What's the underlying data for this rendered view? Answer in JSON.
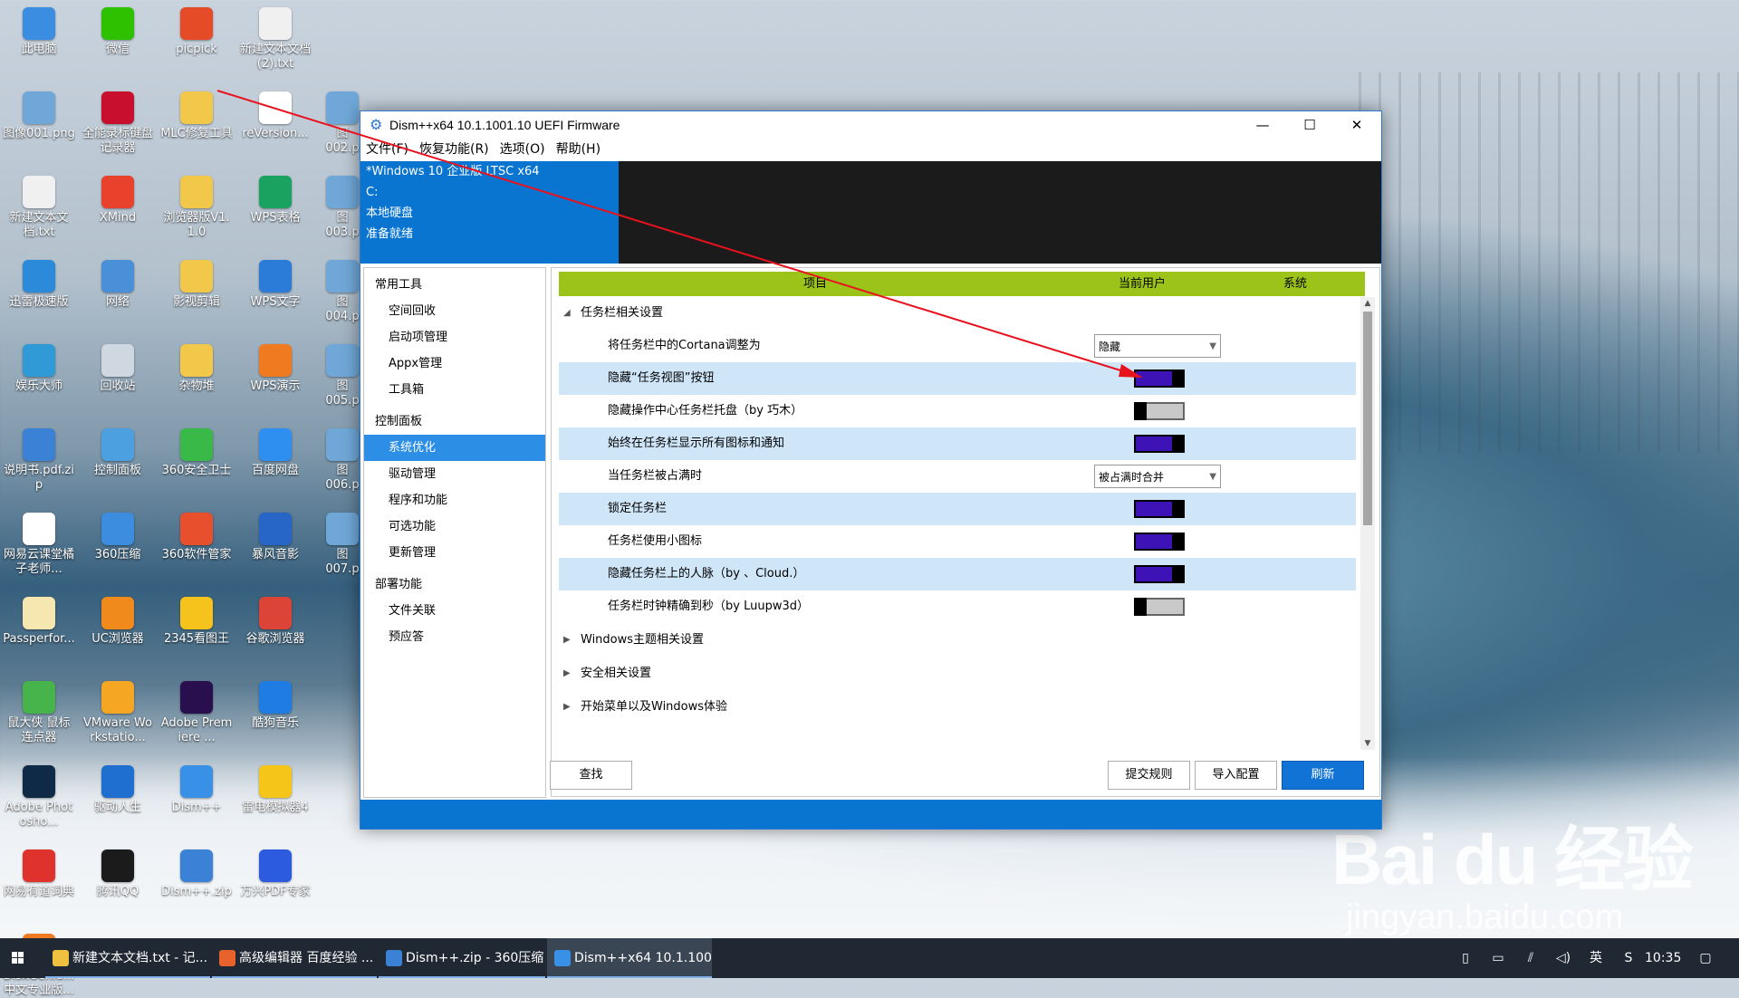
{
  "colors": {
    "accent": "#0a75d0",
    "header_green": "#9cc31a",
    "toggle_on": "#3d13b8",
    "row_alt": "#cfe5f8",
    "annotation_arrow": "#e8121e"
  },
  "desktop_icons": [
    {
      "label": "此电脑",
      "icon": "computer-icon",
      "color": "#3a8de0"
    },
    {
      "label": "微信",
      "icon": "wechat-icon",
      "color": "#2dc100"
    },
    {
      "label": "picpick",
      "icon": "picpick-icon",
      "color": "#e44b26"
    },
    {
      "label": "新建文本文档 (2).txt",
      "icon": "text-file-icon",
      "color": "#f0f0f0"
    },
    {
      "label": "图像001.png",
      "icon": "image-file-icon",
      "color": "#6fa8d8"
    },
    {
      "label": "全能录标键盘记录器",
      "icon": "recorder-icon",
      "color": "#c8102e"
    },
    {
      "label": "MLC修复工具",
      "icon": "folder-icon",
      "color": "#f2c84b"
    },
    {
      "label": "reVersion...",
      "icon": "document-icon",
      "color": "#ffffff"
    },
    {
      "label": "新建文本文档.txt",
      "icon": "text-file-icon",
      "color": "#f0f0f0"
    },
    {
      "label": "XMind",
      "icon": "xmind-icon",
      "color": "#e8412c"
    },
    {
      "label": "浏览器版V1.1.0",
      "icon": "folder-icon",
      "color": "#f2c84b"
    },
    {
      "label": "WPS表格",
      "icon": "wps-sheet-icon",
      "color": "#1aa260"
    },
    {
      "label": "迅雷极速版",
      "icon": "thunder-icon",
      "color": "#2b8ad9"
    },
    {
      "label": "网络",
      "icon": "network-icon",
      "color": "#4a90d9"
    },
    {
      "label": "影视剪辑",
      "icon": "folder-icon",
      "color": "#f2c84b"
    },
    {
      "label": "WPS文字",
      "icon": "wps-writer-icon",
      "color": "#2b7cd9"
    },
    {
      "label": "娱乐大师",
      "icon": "game-icon",
      "color": "#2f9ad6"
    },
    {
      "label": "回收站",
      "icon": "recycle-bin-icon",
      "color": "#cfd8e0"
    },
    {
      "label": "杂物堆",
      "icon": "folder-icon",
      "color": "#f2c84b"
    },
    {
      "label": "WPS演示",
      "icon": "wps-slides-icon",
      "color": "#f07a20"
    },
    {
      "label": "说明书.pdf.zip",
      "icon": "archive-icon",
      "color": "#3b82d6"
    },
    {
      "label": "控制面板",
      "icon": "control-panel-icon",
      "color": "#4ca0e0"
    },
    {
      "label": "360安全卫士",
      "icon": "shield-icon",
      "color": "#38b948"
    },
    {
      "label": "百度网盘",
      "icon": "cloud-icon",
      "color": "#2f8ff0"
    },
    {
      "label": "网易云课堂橘子老师...",
      "icon": "document-icon",
      "color": "#ffffff"
    },
    {
      "label": "360压缩",
      "icon": "archive-icon",
      "color": "#3c8de0"
    },
    {
      "label": "360软件管家",
      "icon": "apps-icon",
      "color": "#e84f2c"
    },
    {
      "label": "暴风音影",
      "icon": "media-icon",
      "color": "#2766c6"
    },
    {
      "label": "Passperfor...",
      "icon": "document-icon",
      "color": "#f6e7b0"
    },
    {
      "label": "UC浏览器",
      "icon": "browser-icon",
      "color": "#f08a1c"
    },
    {
      "label": "2345看图王",
      "icon": "image-viewer-icon",
      "color": "#f6c21c"
    },
    {
      "label": "谷歌浏览器",
      "icon": "chrome-icon",
      "color": "#dc4437"
    },
    {
      "label": "鼠大侠 鼠标连点器",
      "icon": "mouse-icon",
      "color": "#46b44a"
    },
    {
      "label": "VMware Workstatio...",
      "icon": "vmware-icon",
      "color": "#f5a623"
    },
    {
      "label": "Adobe Premiere ...",
      "icon": "premiere-icon",
      "color": "#2a0f4f"
    },
    {
      "label": "酷狗音乐",
      "icon": "music-icon",
      "color": "#1f7ce2"
    },
    {
      "label": "Adobe Photosho...",
      "icon": "photoshop-icon",
      "color": "#0f2a47"
    },
    {
      "label": "驱动人生",
      "icon": "driver-icon",
      "color": "#1e6fd0"
    },
    {
      "label": "Dism++",
      "icon": "gear-icon",
      "color": "#3891e6"
    },
    {
      "label": "雷电模拟器4",
      "icon": "emulator-icon",
      "color": "#f5c518"
    },
    {
      "label": "网易有道词典",
      "icon": "dictionary-icon",
      "color": "#e0322d"
    },
    {
      "label": "腾讯QQ",
      "icon": "qq-icon",
      "color": "#1b1b1b"
    },
    {
      "label": "Dism++.zip",
      "icon": "archive-icon",
      "color": "#3b82d6"
    },
    {
      "label": "万兴PDF专家",
      "icon": "pdf-icon",
      "color": "#2c5be0"
    },
    {
      "label": "DiskGeniu... 中文专业版...",
      "icon": "disk-icon",
      "color": "#f07a20"
    }
  ],
  "partial_desktop_icons": [
    "图",
    "002.p",
    "图",
    "003.p",
    "图",
    "004.p",
    "图",
    "005.p",
    "图",
    "006.p",
    "图",
    "007.p"
  ],
  "window": {
    "title": "Dism++x64 10.1.1001.10 UEFI Firmware",
    "minimize": "—",
    "maximize": "☐",
    "close": "✕",
    "menu": [
      "文件(F)",
      "恢复功能(R)",
      "选项(O)",
      "帮助(H)"
    ],
    "info": {
      "os": "*Windows 10 企业版 LTSC x64",
      "drive": "C:",
      "disk": "本地硬盘",
      "status": "准备就绪"
    },
    "sidebar": [
      {
        "type": "group",
        "label": "常用工具"
      },
      {
        "type": "item",
        "label": "空间回收",
        "name": "space-reclaim"
      },
      {
        "type": "item",
        "label": "启动项管理",
        "name": "startup-manager"
      },
      {
        "type": "item",
        "label": "Appx管理",
        "name": "appx-manager"
      },
      {
        "type": "item",
        "label": "工具箱",
        "name": "toolbox"
      },
      {
        "type": "group",
        "label": "控制面板"
      },
      {
        "type": "item",
        "label": "系统优化",
        "name": "system-optimize",
        "active": true
      },
      {
        "type": "item",
        "label": "驱动管理",
        "name": "driver-manager"
      },
      {
        "type": "item",
        "label": "程序和功能",
        "name": "programs-features"
      },
      {
        "type": "item",
        "label": "可选功能",
        "name": "optional-features"
      },
      {
        "type": "item",
        "label": "更新管理",
        "name": "update-manager"
      },
      {
        "type": "group",
        "label": "部署功能"
      },
      {
        "type": "item",
        "label": "文件关联",
        "name": "file-association"
      },
      {
        "type": "item",
        "label": "预应答",
        "name": "pre-answer"
      }
    ],
    "table_header": {
      "item": "项目",
      "current_user": "当前用户",
      "system": "系统"
    },
    "sections": [
      {
        "label": "任务栏相关设置",
        "expanded": true,
        "arrow": "◢",
        "rows": [
          {
            "label": "将任务栏中的Cortana调整为",
            "control": "dropdown",
            "value": "隐藏",
            "alt": false
          },
          {
            "label": "隐藏“任务视图”按钮",
            "control": "toggle",
            "on": true,
            "alt": true
          },
          {
            "label": "隐藏操作中心任务栏托盘（by 巧木）",
            "control": "toggle",
            "on": false,
            "alt": false
          },
          {
            "label": "始终在任务栏显示所有图标和通知",
            "control": "toggle",
            "on": true,
            "alt": true
          },
          {
            "label": "当任务栏被占满时",
            "control": "dropdown",
            "value": "被占满时合并",
            "alt": false
          },
          {
            "label": "锁定任务栏",
            "control": "toggle",
            "on": true,
            "alt": true
          },
          {
            "label": "任务栏使用小图标",
            "control": "toggle",
            "on": true,
            "alt": false
          },
          {
            "label": "隐藏任务栏上的人脉（by 、Cloud.）",
            "control": "toggle",
            "on": true,
            "alt": true
          },
          {
            "label": "任务栏时钟精确到秒（by Luupw3d）",
            "control": "toggle",
            "on": false,
            "alt": false
          }
        ]
      },
      {
        "label": "Windows主题相关设置",
        "expanded": false,
        "arrow": "▶",
        "rows": []
      },
      {
        "label": "安全相关设置",
        "expanded": false,
        "arrow": "▶",
        "rows": []
      },
      {
        "label": "开始菜单以及Windows体验",
        "expanded": false,
        "arrow": "▶",
        "rows": []
      }
    ],
    "scroll": {
      "up": "▲",
      "down": "▼"
    },
    "buttons": {
      "find": "查找",
      "submit_rules": "提交规则",
      "import_config": "导入配置",
      "refresh": "刷新"
    }
  },
  "taskbar": {
    "tasks": [
      {
        "label": "新建文本文档.txt - 记...",
        "icon_color": "#f0c040",
        "state": "running"
      },
      {
        "label": "高级编辑器 百度经验 ...",
        "icon_color": "#e8622c",
        "state": "running"
      },
      {
        "label": "Dism++.zip - 360压缩",
        "icon_color": "#3b82d6",
        "state": "running"
      },
      {
        "label": "Dism++x64 10.1.100...",
        "icon_color": "#3891e6",
        "state": "active"
      }
    ],
    "tray": [
      "▯",
      "▭",
      "⫽",
      "◁)",
      "英",
      "S"
    ],
    "clock": "10:35",
    "notification": "▢"
  },
  "watermark": {
    "main": "Bai du 经验",
    "sub": "jingyan.baidu.com"
  }
}
